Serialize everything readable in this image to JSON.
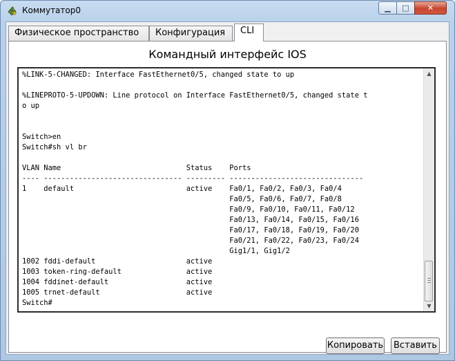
{
  "window": {
    "title": "Коммутатор0",
    "minimize_label": "▁",
    "maximize_label": "□",
    "close_label": "✕"
  },
  "tabs": [
    {
      "label": "Физическое пространство",
      "active": false
    },
    {
      "label": "Конфигурация",
      "active": false
    },
    {
      "label": "CLI",
      "active": true
    }
  ],
  "cli": {
    "title": "Командный интерфейс IOS",
    "lines": [
      "%LINK-5-CHANGED: Interface FastEthernet0/5, changed state to up",
      "",
      "%LINEPROTO-5-UPDOWN: Line protocol on Interface FastEthernet0/5, changed state t",
      "o up",
      "",
      "",
      "Switch>en",
      "Switch#sh vl br",
      "",
      "VLAN Name                             Status    Ports",
      "---- -------------------------------- --------- -------------------------------",
      "1    default                          active    Fa0/1, Fa0/2, Fa0/3, Fa0/4",
      "                                                Fa0/5, Fa0/6, Fa0/7, Fa0/8",
      "                                                Fa0/9, Fa0/10, Fa0/11, Fa0/12",
      "                                                Fa0/13, Fa0/14, Fa0/15, Fa0/16",
      "                                                Fa0/17, Fa0/18, Fa0/19, Fa0/20",
      "                                                Fa0/21, Fa0/22, Fa0/23, Fa0/24",
      "                                                Gig1/1, Gig1/2",
      "1002 fddi-default                     active",
      "1003 token-ring-default               active",
      "1004 fddinet-default                  active",
      "1005 trnet-default                    active",
      "Switch#"
    ]
  },
  "buttons": {
    "copy": "Копировать",
    "paste": "Вставить"
  },
  "icons": {
    "app": "packet-tracer-switch-icon",
    "scroll_up": "▲",
    "scroll_down": "▼"
  }
}
